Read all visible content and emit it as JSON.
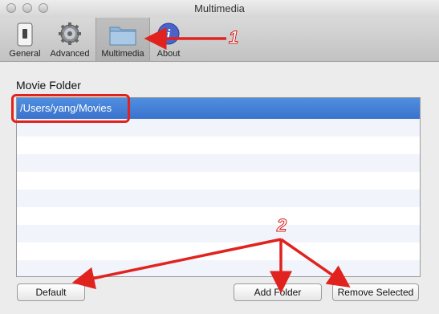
{
  "window": {
    "title": "Multimedia"
  },
  "toolbar": {
    "items": [
      {
        "label": "General",
        "icon": "switch-icon"
      },
      {
        "label": "Advanced",
        "icon": "gear-icon"
      },
      {
        "label": "Multimedia",
        "icon": "folder-icon",
        "selected": true
      },
      {
        "label": "About",
        "icon": "info-icon"
      }
    ]
  },
  "panel": {
    "title": "Movie Folder",
    "folders": [
      "/Users/yang/Movies"
    ]
  },
  "buttons": {
    "default": "Default",
    "add_folder": "Add Folder",
    "remove_selected": "Remove Selected"
  },
  "annotations": {
    "callout_1": "1",
    "callout_2": "2",
    "arrow_color": "#e0231f"
  }
}
